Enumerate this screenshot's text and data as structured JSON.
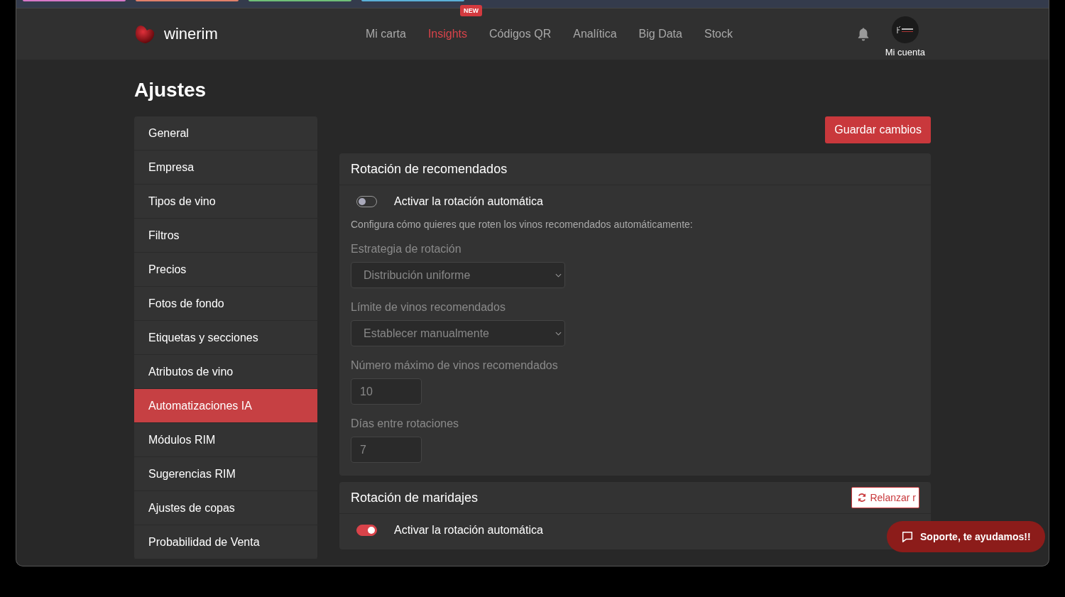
{
  "header": {
    "brand": "winerim",
    "nav": [
      {
        "label": "Mi carta",
        "selected": false
      },
      {
        "label": "Insights",
        "selected": true,
        "badge": "NEW"
      },
      {
        "label": "Códigos QR",
        "selected": false
      },
      {
        "label": "Analítica",
        "selected": false
      },
      {
        "label": "Big Data",
        "selected": false
      },
      {
        "label": "Stock",
        "selected": false
      }
    ],
    "account": "Mi cuenta"
  },
  "page_title": "Ajustes",
  "sidebar": {
    "items": [
      {
        "label": "General",
        "selected": false
      },
      {
        "label": "Empresa",
        "selected": false
      },
      {
        "label": "Tipos de vino",
        "selected": false
      },
      {
        "label": "Filtros",
        "selected": false
      },
      {
        "label": "Precios",
        "selected": false
      },
      {
        "label": "Fotos de fondo",
        "selected": false
      },
      {
        "label": "Etiquetas y secciones",
        "selected": false
      },
      {
        "label": "Atributos de vino",
        "selected": false
      },
      {
        "label": "Automatizaciones IA",
        "selected": true
      },
      {
        "label": "Módulos RIM",
        "selected": false
      },
      {
        "label": "Sugerencias RIM",
        "selected": false
      },
      {
        "label": "Ajustes de copas",
        "selected": false
      },
      {
        "label": "Probabilidad de Venta",
        "selected": false
      }
    ]
  },
  "save_button": "Guardar cambios",
  "panels": [
    {
      "title": "Rotación de recomendados",
      "toggle": {
        "label": "Activar la rotación automática",
        "on": false
      },
      "description": "Configura cómo quieres que roten los vinos recomendados automáticamente:",
      "fields": [
        {
          "kind": "select",
          "label": "Estrategia de rotación",
          "value": "Distribución uniforme",
          "disabled": true
        },
        {
          "kind": "select",
          "label": "Límite de vinos recomendados",
          "value": "Establecer manualmente",
          "disabled": true
        },
        {
          "kind": "number",
          "label": "Número máximo de vinos recomendados",
          "value": "10",
          "disabled": true
        },
        {
          "kind": "number",
          "label": "Días entre rotaciones",
          "value": "7",
          "disabled": true
        }
      ]
    },
    {
      "title": "Rotación de maridajes",
      "action": "Relanzar r",
      "toggle": {
        "label": "Activar la rotación automática",
        "on": true
      }
    }
  ],
  "support_button": "Soporte, te ayudamos!!"
}
